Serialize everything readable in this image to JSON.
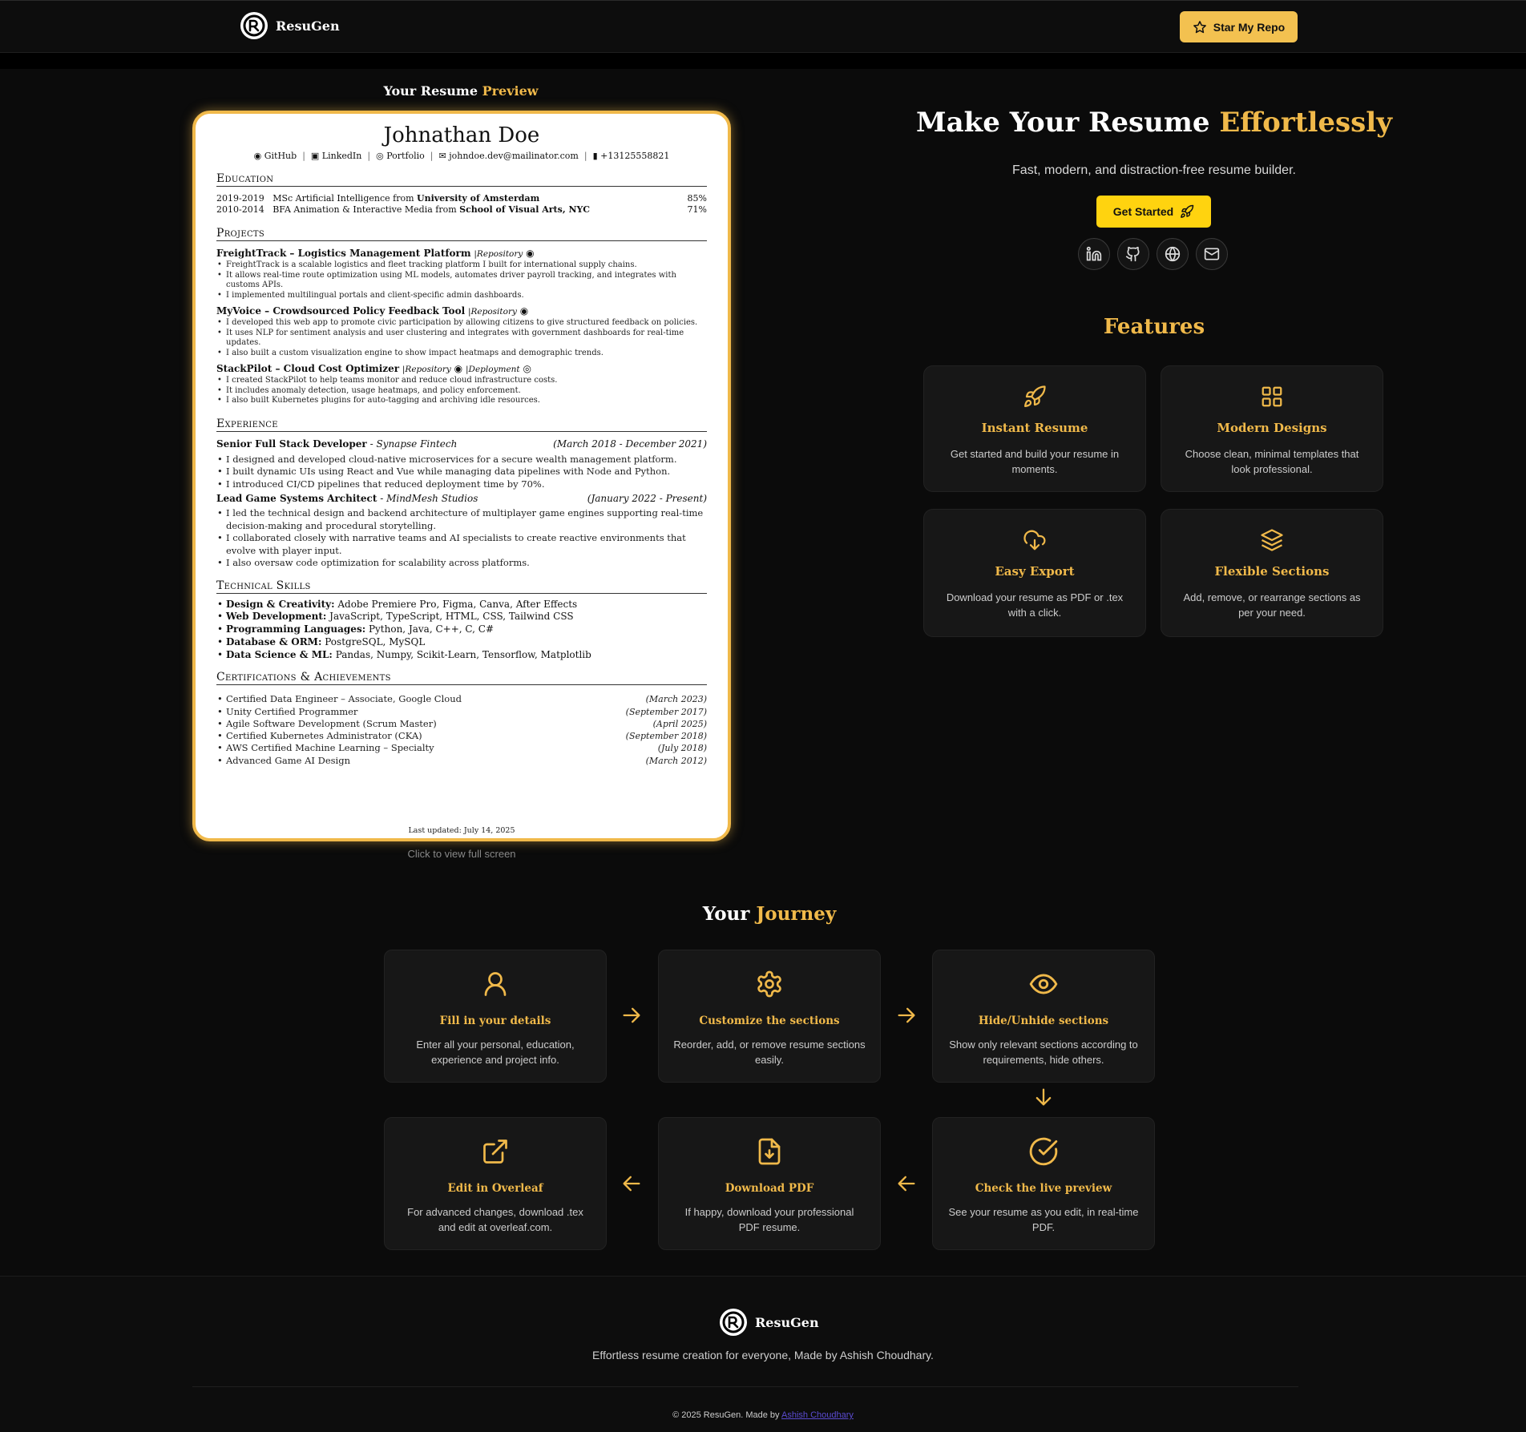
{
  "nav": {
    "brand": "ResuGen",
    "star_label": "Star My Repo"
  },
  "preview": {
    "label_prefix": "Your Resume ",
    "label_highlight": "Preview",
    "hint": "Click to view full screen"
  },
  "resume": {
    "name": "Johnathan Doe",
    "contact": [
      "GitHub",
      "LinkedIn",
      "Portfolio",
      "johndoe.dev@mailinator.com",
      "+13125558821"
    ],
    "sections": {
      "education": "Education",
      "projects": "Projects",
      "experience": "Experience",
      "skills": "Technical Skills",
      "certs": "Certifications & Achievements"
    },
    "education": [
      {
        "years": "2019-2019",
        "degree": "MSc Artificial Intelligence from ",
        "school": "University of Amsterdam",
        "grade": "85%"
      },
      {
        "years": "2010-2014",
        "degree": "BFA Animation & Interactive Media from ",
        "school": "School of Visual Arts, NYC",
        "grade": "71%"
      }
    ],
    "projects": [
      {
        "title": "FreightTrack – Logistics Management Platform",
        "links": "|Repository",
        "bullets": [
          "FreightTrack is a scalable logistics and fleet tracking platform I built for international supply chains.",
          "It allows real-time route optimization using ML models, automates driver payroll tracking, and integrates with customs APIs.",
          "I implemented multilingual portals and client-specific admin dashboards."
        ]
      },
      {
        "title": "MyVoice – Crowdsourced Policy Feedback Tool",
        "links": "|Repository",
        "bullets": [
          "I developed this web app to promote civic participation by allowing citizens to give structured feedback on policies.",
          "It uses NLP for sentiment analysis and user clustering and integrates with government dashboards for real-time updates.",
          "I also built a custom visualization engine to show impact heatmaps and demographic trends."
        ]
      },
      {
        "title": "StackPilot – Cloud Cost Optimizer",
        "links": "|Repository",
        "links2": "|Deployment",
        "bullets": [
          "I created StackPilot to help teams monitor and reduce cloud infrastructure costs.",
          "It includes anomaly detection, usage heatmaps, and policy enforcement.",
          "I also built Kubernetes plugins for auto-tagging and archiving idle resources."
        ]
      }
    ],
    "experience": [
      {
        "role": "Senior Full Stack Developer",
        "company": "Synapse Fintech",
        "dates": "(March 2018 - December 2021)",
        "bullets": [
          "I designed and developed cloud-native microservices for a secure wealth management platform.",
          "I built dynamic UIs using React and Vue while managing data pipelines with Node and Python.",
          "I introduced CI/CD pipelines that reduced deployment time by 70%."
        ]
      },
      {
        "role": "Lead Game Systems Architect",
        "company": "MindMesh Studios",
        "dates": "(January 2022 - Present)",
        "bullets": [
          "I led the technical design and backend architecture of multiplayer game engines supporting real-time decision-making and procedural storytelling.",
          "I collaborated closely with narrative teams and AI specialists to create reactive environments that evolve with player input.",
          "I also oversaw code optimization for scalability across platforms."
        ]
      }
    ],
    "skills": [
      {
        "label": "Design & Creativity:",
        "value": "Adobe Premiere Pro, Figma, Canva, After Effects"
      },
      {
        "label": "Web Development:",
        "value": "JavaScript, TypeScript, HTML, CSS, Tailwind CSS"
      },
      {
        "label": "Programming Languages:",
        "value": "Python, Java, C++, C, C#"
      },
      {
        "label": "Database & ORM:",
        "value": "PostgreSQL, MySQL"
      },
      {
        "label": "Data Science & ML:",
        "value": "Pandas, Numpy, Scikit-Learn, Tensorflow, Matplotlib"
      }
    ],
    "certs": [
      {
        "name": "Certified Data Engineer – Associate, Google Cloud",
        "date": "(March 2023)"
      },
      {
        "name": "Unity Certified Programmer",
        "date": "(September 2017)"
      },
      {
        "name": "Agile Software Development (Scrum Master)",
        "date": "(April 2025)"
      },
      {
        "name": "Certified Kubernetes Administrator (CKA)",
        "date": "(September 2018)"
      },
      {
        "name": "AWS Certified Machine Learning – Specialty",
        "date": "(July 2018)"
      },
      {
        "name": "Advanced Game AI Design",
        "date": "(March 2012)"
      }
    ],
    "footer": "Last updated: July 14, 2025"
  },
  "hero": {
    "title_prefix": "Make Your Resume ",
    "title_highlight": "Effortlessly",
    "subtitle": "Fast, modern, and distraction-free resume builder.",
    "cta": "Get Started",
    "socials": [
      "linkedin-icon",
      "github-icon",
      "globe-icon",
      "mail-icon"
    ]
  },
  "features": {
    "title": "Features",
    "items": [
      {
        "icon": "rocket-icon",
        "title": "Instant Resume",
        "desc": "Get started and build your resume in moments."
      },
      {
        "icon": "grid-icon",
        "title": "Modern Designs",
        "desc": "Choose clean, minimal templates that look professional."
      },
      {
        "icon": "cloud-download-icon",
        "title": "Easy Export",
        "desc": "Download your resume as PDF or .tex with a click."
      },
      {
        "icon": "layers-icon",
        "title": "Flexible Sections",
        "desc": "Add, remove, or rearrange sections as per your need."
      }
    ]
  },
  "journey": {
    "title_prefix": "Your ",
    "title_highlight": "Journey",
    "steps": [
      {
        "icon": "user-icon",
        "title": "Fill in your details",
        "desc": "Enter all your personal, education, experience and project info."
      },
      {
        "icon": "gear-icon",
        "title": "Customize the sections",
        "desc": "Reorder, add, or remove resume sections easily."
      },
      {
        "icon": "eye-icon",
        "title": "Hide/Unhide sections",
        "desc": "Show only relevant sections according to requirements, hide others."
      },
      {
        "icon": "check-circle-icon",
        "title": "Check the live preview",
        "desc": "See your resume as you edit, in real-time PDF."
      },
      {
        "icon": "file-download-icon",
        "title": "Download PDF",
        "desc": "If happy, download your professional PDF resume."
      },
      {
        "icon": "external-link-icon",
        "title": "Edit in Overleaf",
        "desc": "For advanced changes, download .tex and edit at overleaf.com."
      }
    ]
  },
  "footer": {
    "brand": "ResuGen",
    "tagline": "Effortless resume creation for everyone, Made by Ashish Choudhary.",
    "copy_prefix": "© 2025 ResuGen. Made by ",
    "copy_link": "Ashish Choudhary"
  },
  "colors": {
    "accent": "#f0b94a",
    "cta": "#ffd30f",
    "background": "#0b0b0b",
    "card": "#171717"
  }
}
